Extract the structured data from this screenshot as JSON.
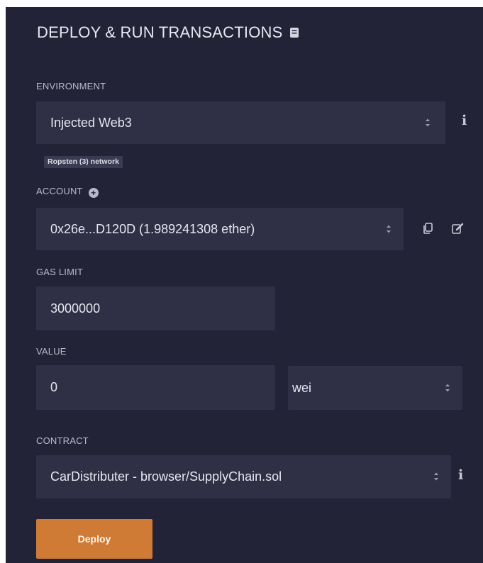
{
  "header": {
    "title": "DEPLOY & RUN TRANSACTIONS",
    "doc_icon": "book-icon"
  },
  "environment": {
    "label": "ENVIRONMENT",
    "value": "Injected Web3",
    "network_badge": "Ropsten (3) network"
  },
  "account": {
    "label": "ACCOUNT",
    "value": "0x26e...D120D (1.989241308 ether)"
  },
  "gas_limit": {
    "label": "GAS LIMIT",
    "value": "3000000"
  },
  "value": {
    "label": "VALUE",
    "amount": "0",
    "unit": "wei"
  },
  "contract": {
    "label": "CONTRACT",
    "value": "CarDistributer - browser/SupplyChain.sol"
  },
  "deploy": {
    "label": "Deploy"
  },
  "colors": {
    "panel_bg": "#222336",
    "field_bg": "#2f3045",
    "deploy_orange": "#cf7b35"
  }
}
